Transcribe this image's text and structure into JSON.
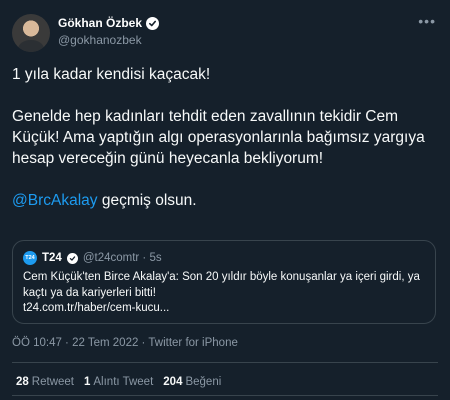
{
  "author": {
    "display_name": "Gökhan Özbek",
    "handle": "@gokhanozbek"
  },
  "tweet": {
    "para1": "1 yıla kadar kendisi kaçacak!",
    "para2": "Genelde hep kadınları tehdit eden zavallının tekidir Cem Küçük! Ama yaptığın algı operasyonlarınla bağımsız yargıya hesap vereceğin günü heyecanla bekliyorum!",
    "mention": "@BrcAkalay",
    "after_mention": " geçmiş olsun."
  },
  "quoted": {
    "logo_text": "T24",
    "name": "T24",
    "handle_time": "@t24comtr · 5s",
    "line1": "Cem Küçük'ten Birce Akalay'a: Son 20 yıldır böyle konuşanlar ya içeri girdi, ya kaçtı ya da kariyerleri bitti!",
    "link": "t24.com.tr/haber/cem-kucu..."
  },
  "meta": "ÖÖ 10:47 · 22 Tem 2022 · Twitter for iPhone",
  "stats": {
    "retweets_num": "28",
    "retweets_label": "Retweet",
    "quotes_num": "1",
    "quotes_label": "Alıntı Tweet",
    "likes_num": "204",
    "likes_label": "Beğeni"
  },
  "icons": {
    "verified": "verified-badge-icon",
    "more": "more-dots-icon"
  },
  "colors": {
    "background": "#15202b",
    "accent": "#1d9bf0",
    "secondary_text": "#8b98a5",
    "border": "#38444d"
  }
}
